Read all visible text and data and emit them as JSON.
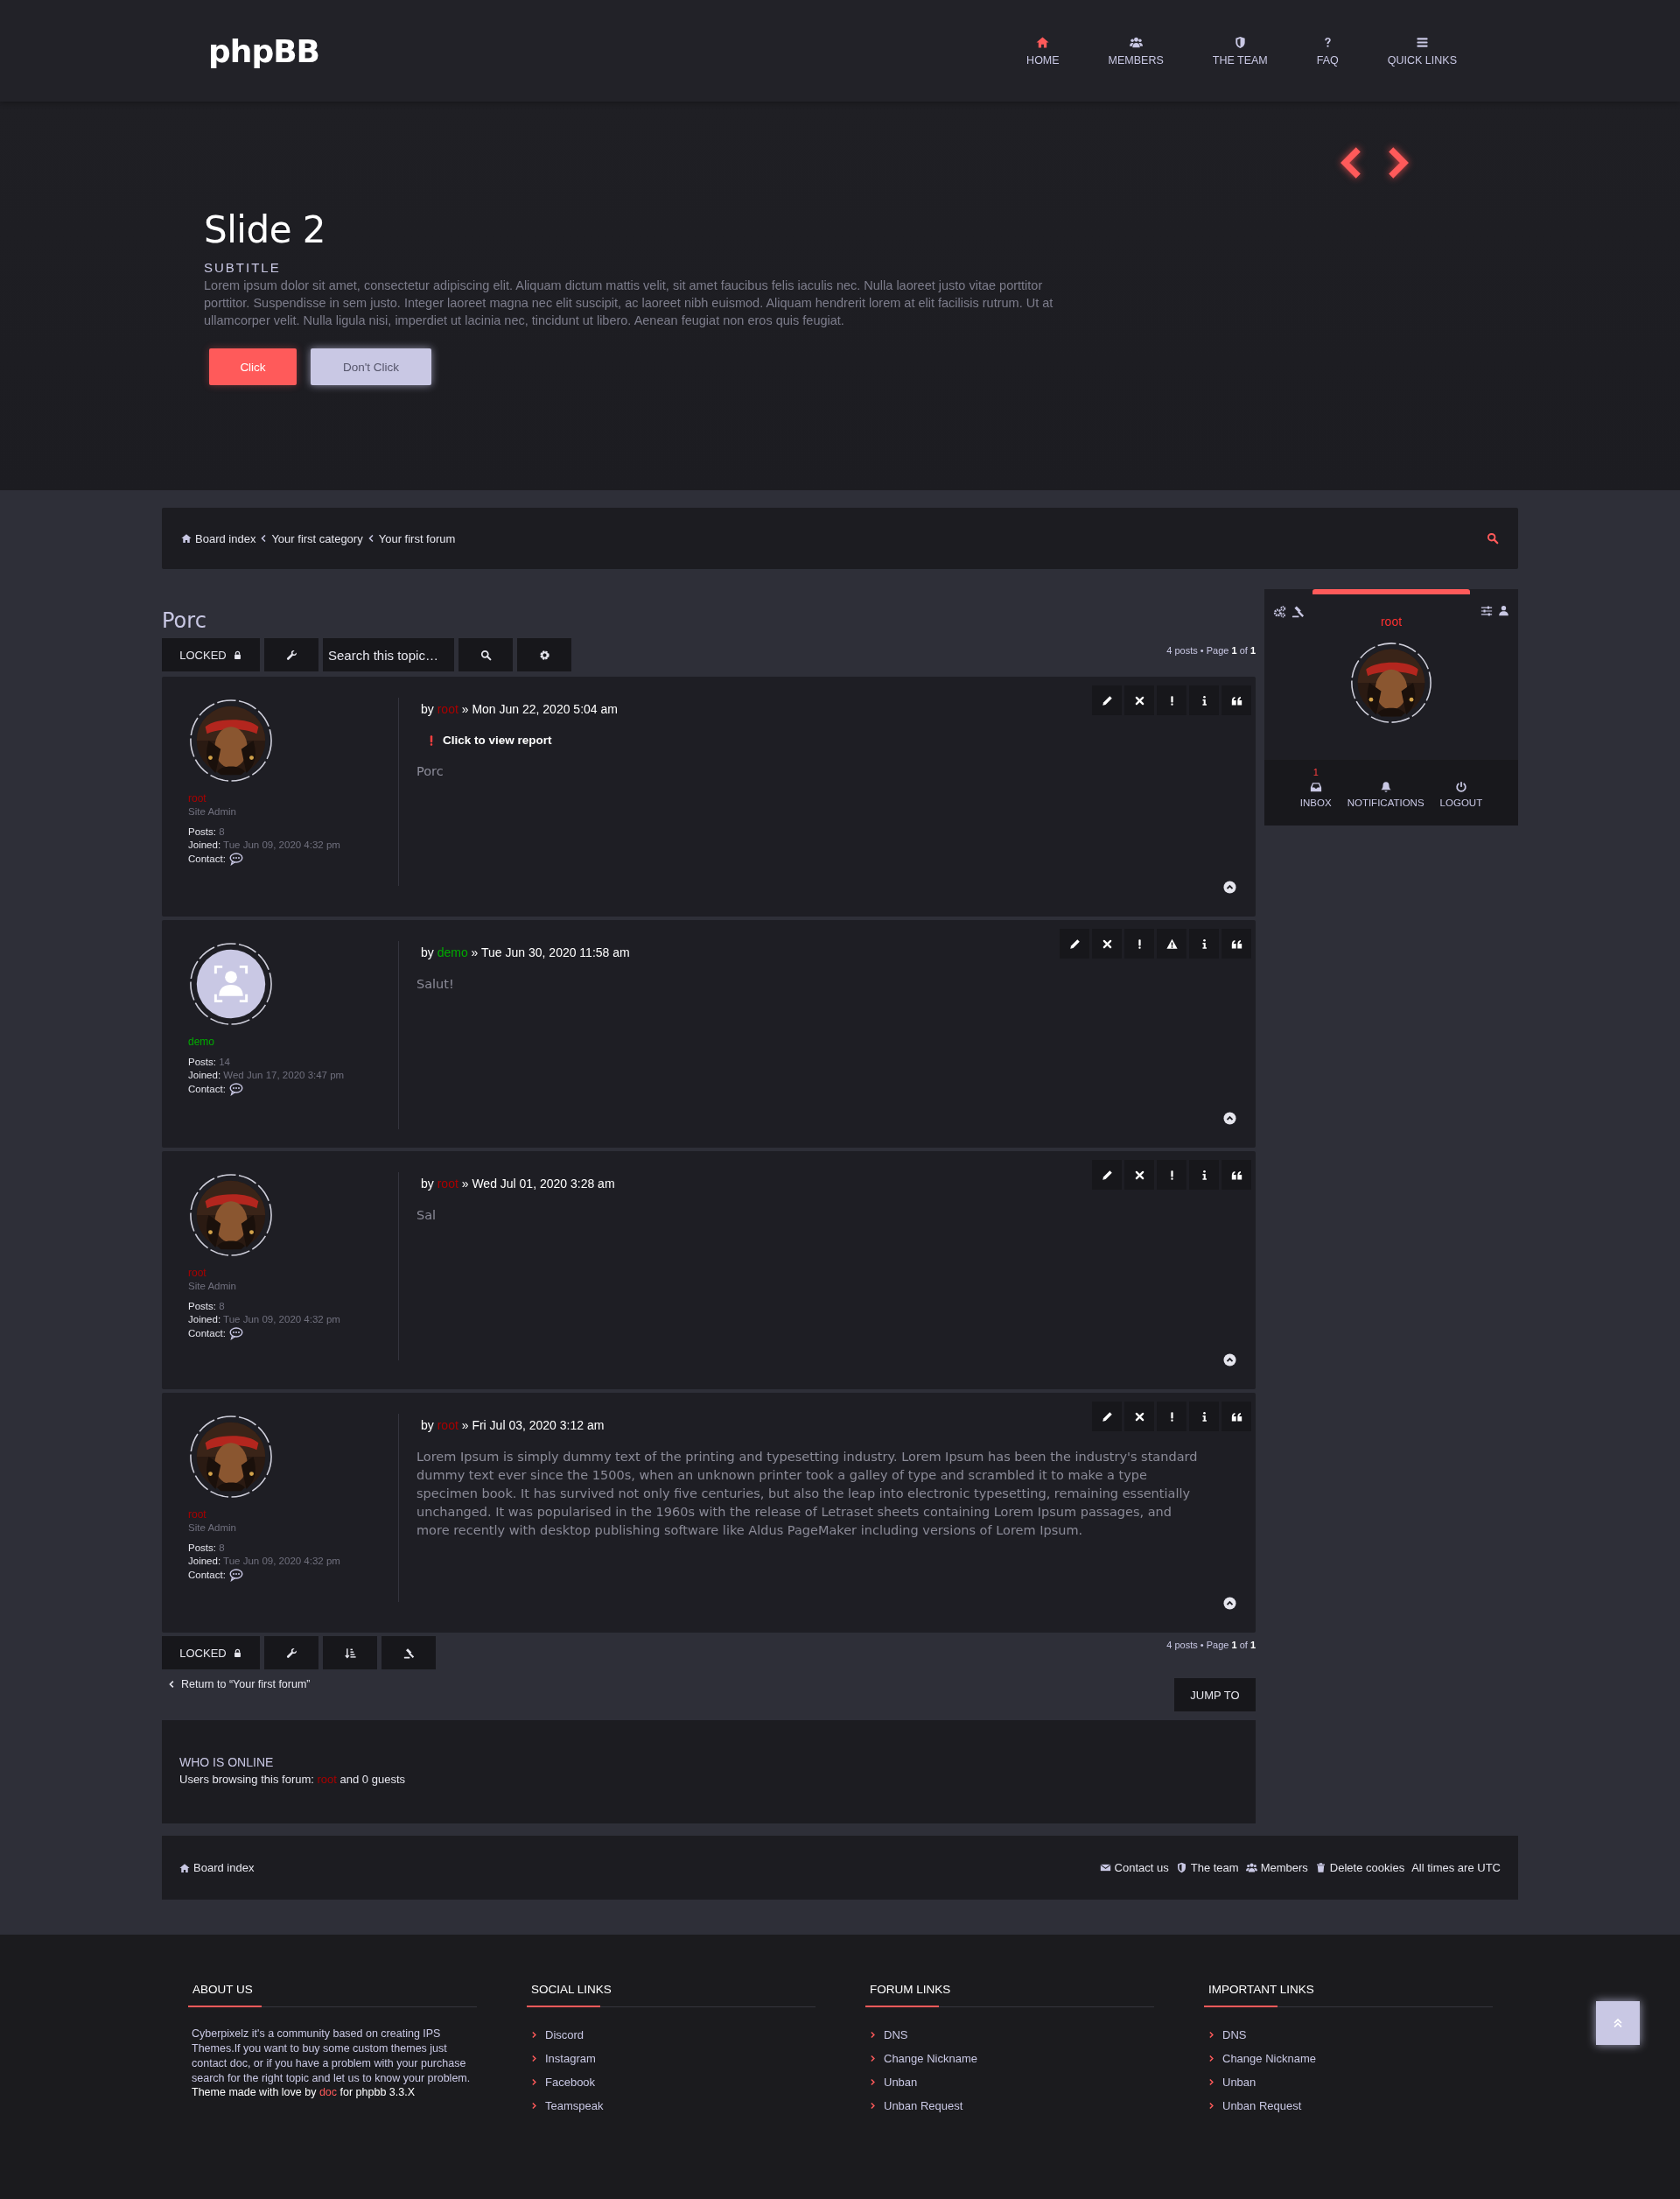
{
  "header": {
    "logo": "phpBB",
    "nav": [
      {
        "label": "HOME",
        "selected": true
      },
      {
        "label": "MEMBERS",
        "selected": false
      },
      {
        "label": "THE TEAM",
        "selected": false
      },
      {
        "label": "FAQ",
        "selected": false
      },
      {
        "label": "QUICK LINKS",
        "selected": false
      }
    ]
  },
  "hero": {
    "title": "Slide 2",
    "subtitle": "SUBTITLE",
    "text": "Lorem ipsum dolor sit amet, consectetur adipiscing elit. Aliquam dictum mattis velit, sit amet faucibus felis iaculis nec. Nulla laoreet justo vitae porttitor porttitor. Suspendisse in sem justo. Integer laoreet magna nec elit suscipit, ac laoreet nibh euismod. Aliquam hendrerit lorem at elit facilisis rutrum. Ut at ullamcorper velit. Nulla ligula nisi, imperdiet ut lacinia nec, tincidunt ut libero. Aenean feugiat non eros quis feugiat.",
    "buttons": [
      {
        "label": "Click",
        "kind": "primary"
      },
      {
        "label": "Don't Click",
        "kind": "secondary"
      }
    ]
  },
  "breadcrumbs": [
    {
      "label": "Board index"
    },
    {
      "label": "Your first category"
    },
    {
      "label": "Your first forum"
    }
  ],
  "topic": {
    "title": "Porc",
    "status": "LOCKED",
    "search": {
      "placeholder": "Search this topic…"
    },
    "pagination": "4 posts • Page **1** of **1**"
  },
  "posts": [
    {
      "author": "root",
      "color": "#aa0000",
      "rank": "Site Admin",
      "posts_label": "Posts:",
      "posts": "8",
      "joined_label": "Joined:",
      "joined": "Tue Jun 09, 2020 4:32 pm",
      "contact_label": "Contact:",
      "by": "by",
      "post_author": "root",
      "date": "» Mon Jun 22, 2020 5:04 am",
      "report": "Click to view report",
      "body": "Porc",
      "warn_button": false
    },
    {
      "author": "demo",
      "color": "#00aa00",
      "avatar": {
        "kind": "default"
      },
      "posts_label": "Posts:",
      "posts": "14",
      "joined_label": "Joined:",
      "joined": "Wed Jun 17, 2020 3:47 pm",
      "contact_label": "Contact:",
      "by": "by",
      "post_author": "demo",
      "date": "» Tue Jun 30, 2020 11:58 am",
      "body": "Salut!",
      "warn_button": true
    },
    {
      "author": "root",
      "color": "#aa0000",
      "rank": "Site Admin",
      "posts_label": "Posts:",
      "posts": "8",
      "joined_label": "Joined:",
      "joined": "Tue Jun 09, 2020 4:32 pm",
      "contact_label": "Contact:",
      "by": "by",
      "post_author": "root",
      "date": "» Wed Jul 01, 2020 3:28 am",
      "body": "Sal",
      "warn_button": false
    },
    {
      "author": "root",
      "color": "#aa0000",
      "rank": "Site Admin",
      "posts_label": "Posts:",
      "posts": "8",
      "joined_label": "Joined:",
      "joined": "Tue Jun 09, 2020 4:32 pm",
      "contact_label": "Contact:",
      "by": "by",
      "post_author": "root",
      "date": "» Fri Jul 03, 2020 3:12 am",
      "body": "Lorem Ipsum is simply dummy text of the printing and typesetting industry. Lorem Ipsum has been the industry's standard dummy text ever since the 1500s, when an unknown printer took a galley of type and scrambled it to make a type specimen book. It has survived not only five centuries, but also the leap into electronic typesetting, remaining essentially unchanged. It was popularised in the 1960s with the release of Letraset sheets containing Lorem Ipsum passages, and more recently with desktop publishing software like Aldus PageMaker including versions of Lorem Ipsum.",
      "warn_button": false
    }
  ],
  "bottom_bar": {
    "status": "LOCKED",
    "pagination": "4 posts • Page **1** of **1**"
  },
  "return_link": "Return to “Your first forum”",
  "jump_to": "JUMP TO",
  "who_is_online": {
    "title": "WHO IS ONLINE",
    "prefix": "Users browsing this forum:",
    "users": [
      {
        "name": "root",
        "color": "#aa0000"
      }
    ],
    "suffix": "and 0 guests"
  },
  "user_panel": {
    "username": "root",
    "items": [
      {
        "label": "INBOX",
        "count": "1"
      },
      {
        "label": "NOTIFICATIONS"
      },
      {
        "label": "LOGOUT"
      }
    ]
  },
  "footer_bar": {
    "home": "Board index",
    "links": [
      {
        "label": "Contact us"
      },
      {
        "label": "The team"
      },
      {
        "label": "Members"
      },
      {
        "label": "Delete cookies"
      }
    ],
    "timezone": "All times are UTC"
  },
  "footer": {
    "about": {
      "title": "ABOUT US",
      "text": "Cyberpixelz it's a community based on creating IPS Themes.If you want to buy some custom themes just contact doc, or if you have a problem with your purchase search for the right topic and let us to know your problem.",
      "credit_prefix": "Theme made with love by",
      "credit_author": "doc",
      "credit_suffix": "for phpbb 3.3.X"
    },
    "columns": [
      {
        "title": "SOCIAL LINKS",
        "links": [
          "Discord",
          "Instagram",
          "Facebook",
          "Teamspeak"
        ]
      },
      {
        "title": "FORUM LINKS",
        "links": [
          "DNS",
          "Change Nickname",
          "Unban",
          "Unban Request"
        ]
      },
      {
        "title": "IMPORTANT LINKS",
        "links": [
          "DNS",
          "Change Nickname",
          "Unban",
          "Unban Request"
        ]
      }
    ]
  }
}
